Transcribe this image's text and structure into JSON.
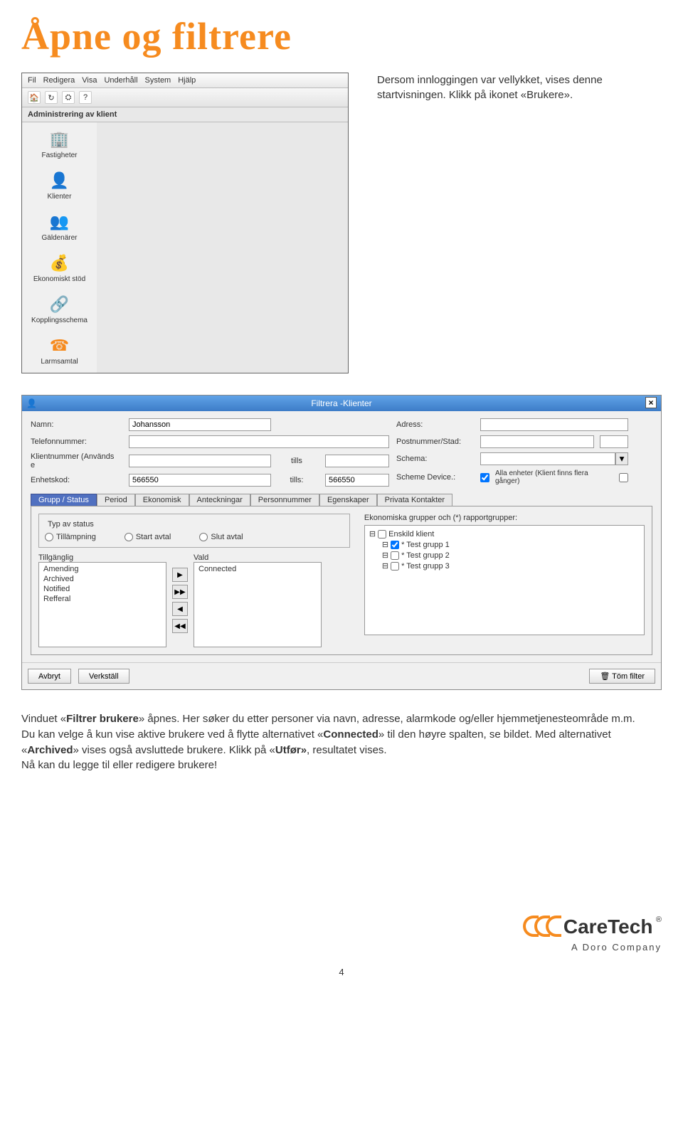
{
  "header": "Åpne og filtrere",
  "intro": "Dersom innloggingen var vellykket, vises denne startvisningen. Klikk på ikonet «Brukere».",
  "menubar": [
    "Fil",
    "Redigera",
    "Visa",
    "Underhåll",
    "System",
    "Hjälp"
  ],
  "sidebar_title": "Administrering av klient",
  "sidebar": [
    {
      "label": "Fastigheter",
      "icon": "🏢"
    },
    {
      "label": "Klienter",
      "icon": "👤"
    },
    {
      "label": "Gäldenärer",
      "icon": "👥"
    },
    {
      "label": "Ekonomiskt stöd",
      "icon": "💰"
    },
    {
      "label": "Kopplingsschema",
      "icon": "🔗"
    },
    {
      "label": "Larmsamtal",
      "icon": "☎"
    }
  ],
  "dialog": {
    "title": "Filtrera -Klienter",
    "labels": {
      "namn": "Namn:",
      "adress": "Adress:",
      "telefon": "Telefonnummer:",
      "postnr": "Postnummer/Stad:",
      "klientnr": "Klientnummer (Används e",
      "tills": "tills",
      "schema": "Schema:",
      "enhet": "Enhetskod:",
      "tills2": "tills:",
      "schemedev": "Scheme Device.:",
      "alla": "Alla enheter (Klient finns flera gånger)"
    },
    "values": {
      "namn": "Johansson",
      "enhetskod": "566550",
      "tills": "566550"
    },
    "tabs": [
      "Grupp / Status",
      "Period",
      "Ekonomisk",
      "Anteckningar",
      "Personnummer",
      "Egenskaper",
      "Privata Kontakter"
    ],
    "status_fieldset": "Typ av status",
    "radios": [
      "Tillämpning",
      "Start avtal",
      "Slut avtal"
    ],
    "tillganglig_label": "Tillgänglig",
    "tillganglig": [
      "Amending",
      "Archived",
      "Notified",
      "Refferal"
    ],
    "vald_label": "Vald",
    "vald": [
      "Connected"
    ],
    "grupper_label": "Ekonomiska grupper och (*) rapportgrupper:",
    "grupper": [
      {
        "label": "Enskild klient",
        "checked": false
      },
      {
        "label": "* Test grupp 1",
        "checked": true
      },
      {
        "label": "* Test grupp 2",
        "checked": false
      },
      {
        "label": "* Test grupp 3",
        "checked": false
      }
    ],
    "buttons": {
      "avbryt": "Avbryt",
      "verkstall": "Verkställ",
      "tom": "Töm filter"
    }
  },
  "body_text": {
    "p1a": "Vinduet «",
    "p1b": "Filtrer brukere",
    "p1c": "» åpnes. Her søker du etter personer via navn, adresse, alarmkode og/eller hjemmetjenesteområde m.m. Du kan velge å kun vise aktive brukere ved å flytte alternativet «",
    "p1d": "Connected",
    "p1e": "» til den høyre spalten, se bildet. Med alternativet «",
    "p1f": "Archived",
    "p1g": "» vises også avsluttede brukere. Klikk på «",
    "p1h": "Utfør»",
    "p1i": ", resultatet vises.",
    "p2": "Nå kan du legge til eller redigere brukere!"
  },
  "logo": {
    "brand": "CareTech",
    "sub": "A Doro Company",
    "reg": "®"
  },
  "page": "4"
}
